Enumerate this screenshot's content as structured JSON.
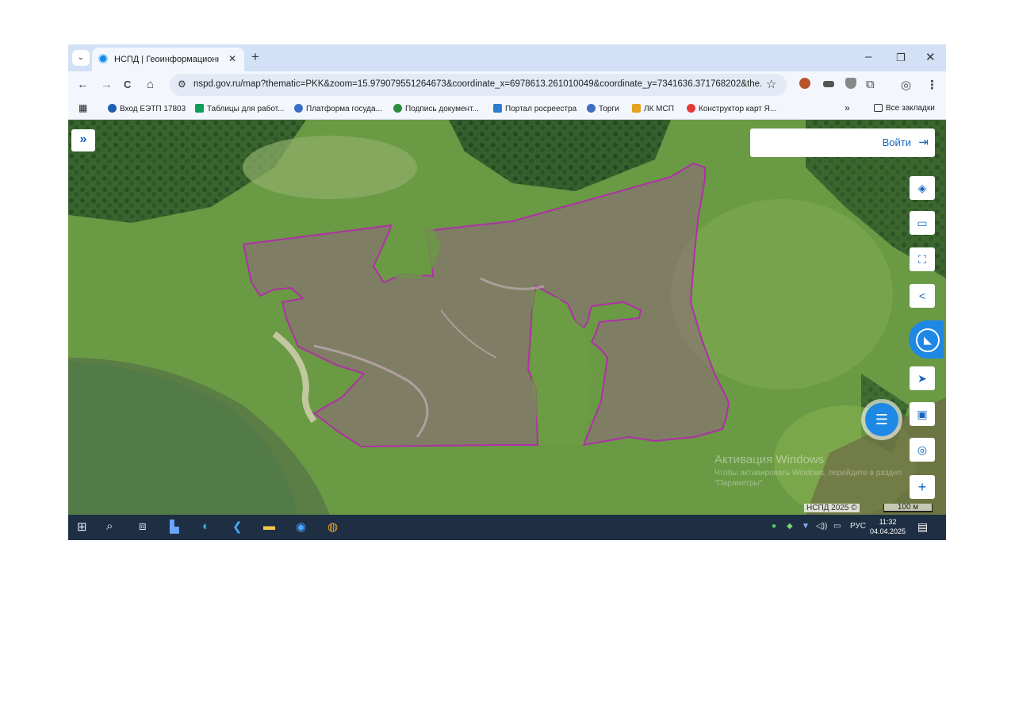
{
  "tab": {
    "title": "НСПД | Геоинформационный",
    "close": "✕",
    "new_tab": "+"
  },
  "window": {
    "minimize": "–",
    "restore": "❐",
    "close": "✕"
  },
  "toolbar": {
    "back": "←",
    "forward": "→",
    "reload": "C",
    "home": "⌂",
    "url": "nspd.gov.ru/map?thematic=PKK&zoom=15.979079551264673&coordinate_x=6978613.261010049&coordinate_y=7341636.371768202&the...",
    "bookmark_star": "☆",
    "profile": "◎",
    "menu": "⋮"
  },
  "bookmarks": {
    "apps": "▦",
    "items": [
      {
        "label": "Вход ЕЭТП 17803",
        "color": "#1e5fb0"
      },
      {
        "label": "Таблицы для работ...",
        "color": "#0f9d58"
      },
      {
        "label": "Платформа госуда...",
        "color": "#3b6fc4"
      },
      {
        "label": "Подпись документ...",
        "color": "#2a8c3c"
      },
      {
        "label": "Портал росреестра",
        "color": "#2e7bcf"
      },
      {
        "label": "Торги",
        "color": "#3f6ec0"
      },
      {
        "label": "ЛК МСП",
        "color": "#e5a21f"
      },
      {
        "label": "Конструктор карт Я...",
        "color": "#e53935"
      }
    ],
    "more": "»",
    "all_bookmarks": "Все закладки"
  },
  "map": {
    "expand": "»",
    "login": "Войти",
    "login_icon": "⇥",
    "controls": [
      "layers-icon",
      "ruler-icon",
      "select-area-icon",
      "share-icon",
      "cadastre-icon",
      "navigate-icon",
      "print-icon",
      "locate-icon",
      "zoom-in-icon"
    ],
    "watermark_title": "Активация Windows",
    "watermark_text": "Чтобы активировать Windows, перейдите в раздел \"Параметры\".",
    "attribution": "НСПД 2025 ©",
    "scale_label": "100 м",
    "parcel_color": "#b02fa8"
  },
  "taskbar": {
    "lang": "РУС",
    "time": "11:32",
    "date": "04.04.2025"
  }
}
